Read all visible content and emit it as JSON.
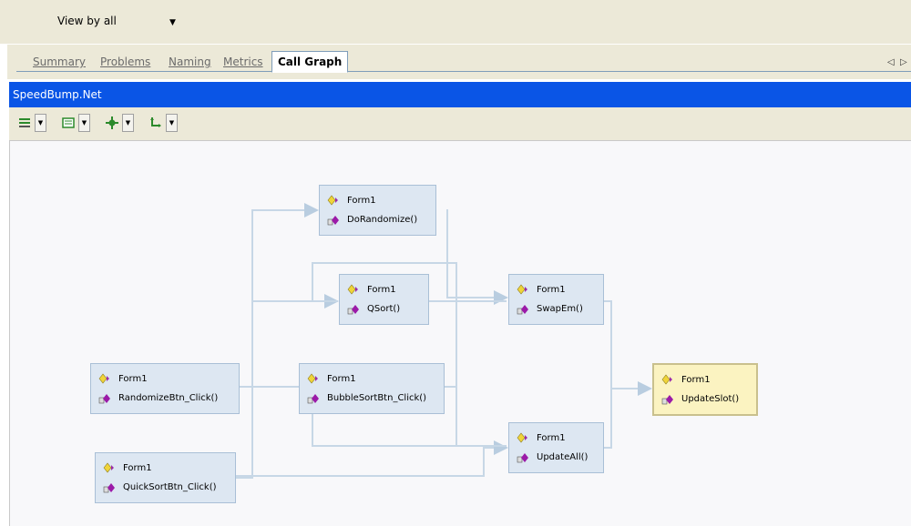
{
  "view_selector": {
    "label": "View by all"
  },
  "tabs": [
    {
      "label": "Summary"
    },
    {
      "label": "Problems"
    },
    {
      "label": "Naming"
    },
    {
      "label": "Metrics"
    },
    {
      "label": "Call Graph"
    }
  ],
  "active_tab": "Call Graph",
  "panel_title": "SpeedBump.Net",
  "toolbar": {
    "buttons": [
      {
        "icon": "layout-icon"
      },
      {
        "icon": "grid-view-icon"
      },
      {
        "icon": "zoom-fit-icon"
      },
      {
        "icon": "connector-icon"
      }
    ]
  },
  "call_graph": {
    "nodes": [
      {
        "id": "dorandomize",
        "class": "Form1",
        "method": "DoRandomize()",
        "selected": false
      },
      {
        "id": "qsort",
        "class": "Form1",
        "method": "QSort()",
        "selected": false
      },
      {
        "id": "swapem",
        "class": "Form1",
        "method": "SwapEm()",
        "selected": false
      },
      {
        "id": "randomizebtn",
        "class": "Form1",
        "method": "RandomizeBtn_Click()",
        "selected": false
      },
      {
        "id": "bubblesortbtn",
        "class": "Form1",
        "method": "BubbleSortBtn_Click()",
        "selected": false
      },
      {
        "id": "updateslot",
        "class": "Form1",
        "method": "UpdateSlot()",
        "selected": true
      },
      {
        "id": "updateall",
        "class": "Form1",
        "method": "UpdateAll()",
        "selected": false
      },
      {
        "id": "quicksortbtn",
        "class": "Form1",
        "method": "QuickSortBtn_Click()",
        "selected": false
      }
    ]
  },
  "colors": {
    "title_bar": "#0a55e6",
    "node_fill": "#dde7f2",
    "node_selected_fill": "#fbf3c1",
    "edge": "#c7d7e6"
  }
}
